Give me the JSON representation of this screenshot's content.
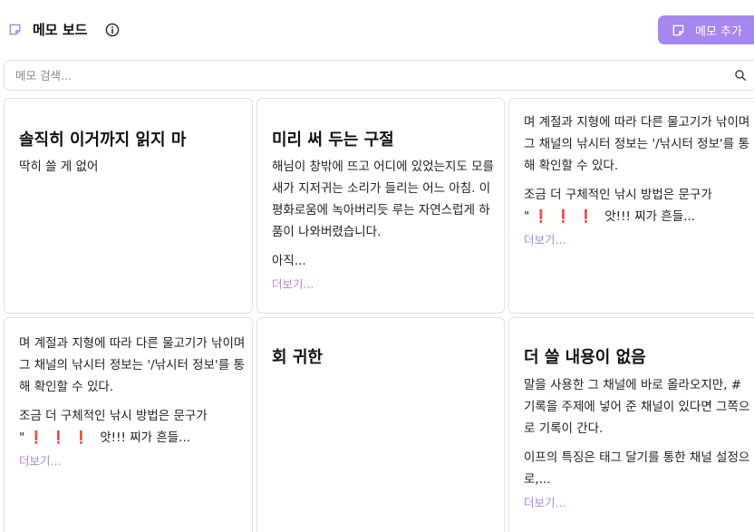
{
  "header": {
    "title": "메모 보드",
    "title_icon": "sticky-note-icon",
    "info_icon": "info-icon",
    "add_button_label": "메모 추가",
    "add_button_icon": "sticky-note-plus-icon"
  },
  "search": {
    "placeholder": "메모 검색...",
    "value": "",
    "icon": "search-icon"
  },
  "colors": {
    "accent": "#a687f0",
    "border": "#e1e1e1",
    "emphasis_red": "#e53935"
  },
  "memos": [
    {
      "title": "솔직히 이거까지 읽지 마",
      "paragraphs": [
        "딱히 쓸 게 없어"
      ]
    },
    {
      "title": "미리 써 두는 구절",
      "paragraphs": [
        "해님이 창밖에 뜨고 어디에 있었는지도 모를 새가 지저귀는 소리가 들리는 어느 아침. 이 평화로움에 녹아버리듯 루는 자연스럽게 하품이 나와버렸습니다.",
        "아직..."
      ],
      "more_label": "더보기..."
    },
    {
      "paragraphs": [
        "며 계절과 지형에 따라 다른 물고기가 낚이며 그 채널의 낚시터 정보는 '/낚시터 정보'를 통해 확인할 수 있다.",
        "조금 더 구체적인 낚시 방법은 문구가",
        "\"",
        "앗!!! 찌가 흔들..."
      ],
      "marks": "❗❗❗",
      "more_label": "더보기..."
    },
    {
      "paragraphs": [
        "며 계절과 지형에 따라 다른 물고기가 낚이며 그 채널의 낚시터 정보는 '/낚시터 정보'를 통해 확인할 수 있다.",
        "조금 더 구체적인 낚시 방법은 문구가",
        "\"",
        "앗!!! 찌가 흔들..."
      ],
      "marks": "❗❗❗",
      "more_label": "더보기..."
    },
    {
      "title": "회 귀한",
      "paragraphs": []
    },
    {
      "title": "더 쓸 내용이 없음",
      "paragraphs": [
        "말을 사용한 그 채널에 바로 올라오지만, #기록을 주제에 넣어 준 채널이 있다면 그쪽으로 기록이 간다.",
        "이프의 특징은 태그 달기를 통한 채널 설정으로,..."
      ],
      "more_label": "더보기..."
    }
  ]
}
